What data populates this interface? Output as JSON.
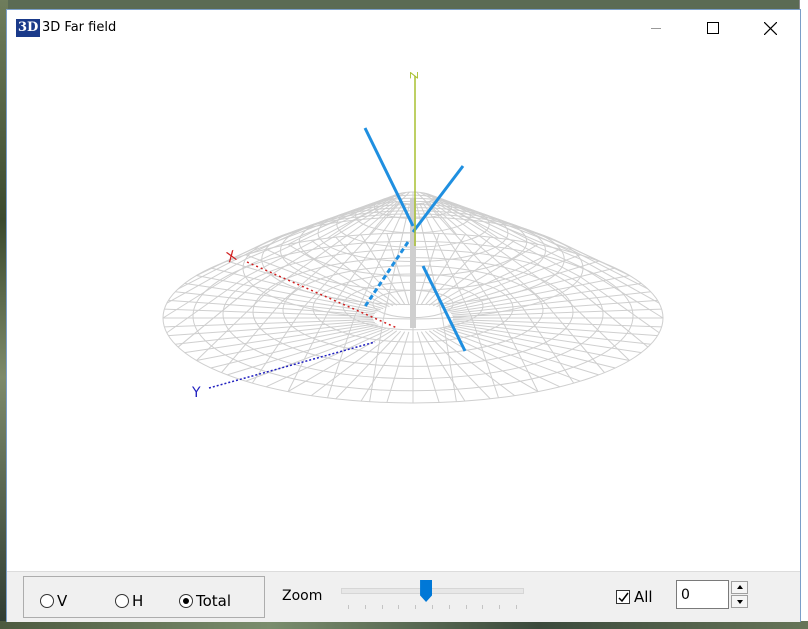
{
  "window": {
    "icon_text": "3D",
    "title": "3D Far field"
  },
  "axes": {
    "x_label": "X",
    "y_label": "Y",
    "z_label": "Z"
  },
  "colors": {
    "mesh": "#cfcfcf",
    "beam": "#1f8fe0",
    "axis_x": "#d02020",
    "axis_y": "#2020c0",
    "axis_z": "#a8c030",
    "accent": "#0078d7"
  },
  "controls": {
    "polarization": {
      "options": [
        {
          "label": "V",
          "selected": false
        },
        {
          "label": "H",
          "selected": false
        },
        {
          "label": "Total",
          "selected": true
        }
      ]
    },
    "zoom": {
      "label": "Zoom",
      "level": 0.47
    },
    "all": {
      "label": "All",
      "checked": true
    },
    "index": {
      "value": "0"
    }
  }
}
